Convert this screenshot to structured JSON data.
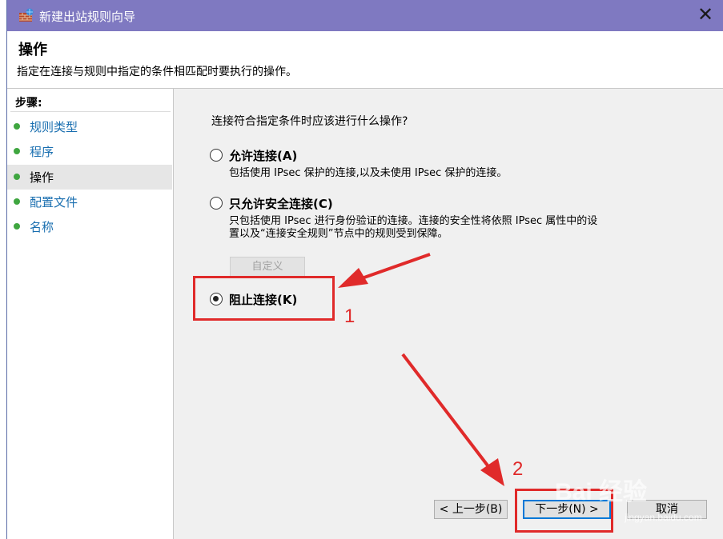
{
  "window": {
    "title": "新建出站规则向导",
    "close_glyph": "✕"
  },
  "header": {
    "title": "操作",
    "description": "指定在连接与规则中指定的条件相匹配时要执行的操作。"
  },
  "steps": {
    "title": "步骤:",
    "items": [
      {
        "label": "规则类型"
      },
      {
        "label": "程序"
      },
      {
        "label": "操作"
      },
      {
        "label": "配置文件"
      },
      {
        "label": "名称"
      }
    ]
  },
  "content": {
    "question": "连接符合指定条件时应该进行什么操作?",
    "options": [
      {
        "label": "允许连接(A)",
        "desc": "包括使用 IPsec 保护的连接,以及未使用 IPsec 保护的连接。",
        "checked": false
      },
      {
        "label": "只允许安全连接(C)",
        "desc_line1": "只包括使用 IPsec 进行身份验证的连接。连接的安全性将依照 IPsec 属性中的设",
        "desc_line2": "置以及“连接安全规则”节点中的规则受到保障。",
        "checked": false
      },
      {
        "label": "阻止连接(K)",
        "checked": true
      }
    ],
    "custom_button": "自定义"
  },
  "buttons": {
    "back": "< 上一步(B)",
    "next": "下一步(N) >",
    "cancel": "取消"
  },
  "annotations": {
    "number1": "1",
    "number2": "2",
    "color": "#e02a2a"
  },
  "watermark": {
    "text": "Bai 经验",
    "sub": "jingyan.baidu.com"
  },
  "colors": {
    "titlebar": "#7f79c1",
    "step_dot": "#3fa640",
    "step_link": "#1a6fb0",
    "accent": "#0078d7"
  }
}
